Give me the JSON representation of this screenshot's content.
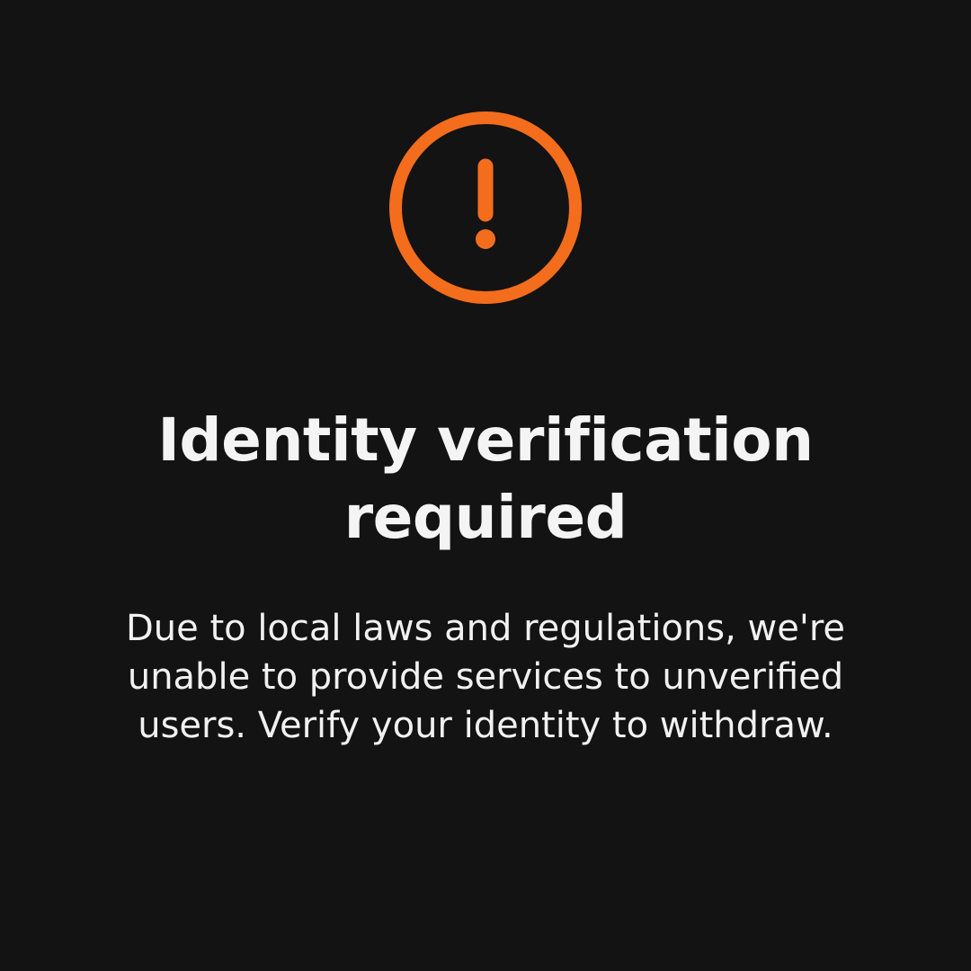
{
  "colors": {
    "background": "#131313",
    "accent": "#f46d1c",
    "text": "#f4f4f4"
  },
  "alert": {
    "icon": "exclamation-circle-icon"
  },
  "dialog": {
    "title": "Identity verification required",
    "message": "Due to local laws and regulations, we're unable to provide services to unverified users. Verify your identity to withdraw."
  }
}
